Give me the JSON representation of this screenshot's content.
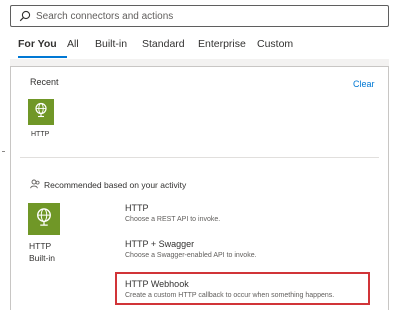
{
  "search": {
    "placeholder": "Search connectors and actions"
  },
  "tabs": [
    {
      "label": "For You",
      "active": true
    },
    {
      "label": "All"
    },
    {
      "label": "Built-in"
    },
    {
      "label": "Standard"
    },
    {
      "label": "Enterprise"
    },
    {
      "label": "Custom"
    }
  ],
  "recent": {
    "label": "Recent",
    "clear_label": "Clear",
    "items": [
      {
        "name": "HTTP",
        "icon": "globe-icon"
      }
    ]
  },
  "recommended": {
    "label": "Recommended based on your activity",
    "icon": "people-icon",
    "connector": {
      "name": "HTTP",
      "type": "Built-in",
      "icon": "globe-icon"
    },
    "actions": [
      {
        "title": "HTTP",
        "description": "Choose a REST API to invoke."
      },
      {
        "title": "HTTP + Swagger",
        "description": "Choose a Swagger-enabled API to invoke."
      },
      {
        "title": "HTTP Webhook",
        "description": "Create a custom HTTP callback to occur when something happens.",
        "highlighted": true
      }
    ]
  },
  "colors": {
    "accent": "#0078d4",
    "tile": "#709727",
    "highlight": "#d13438"
  }
}
